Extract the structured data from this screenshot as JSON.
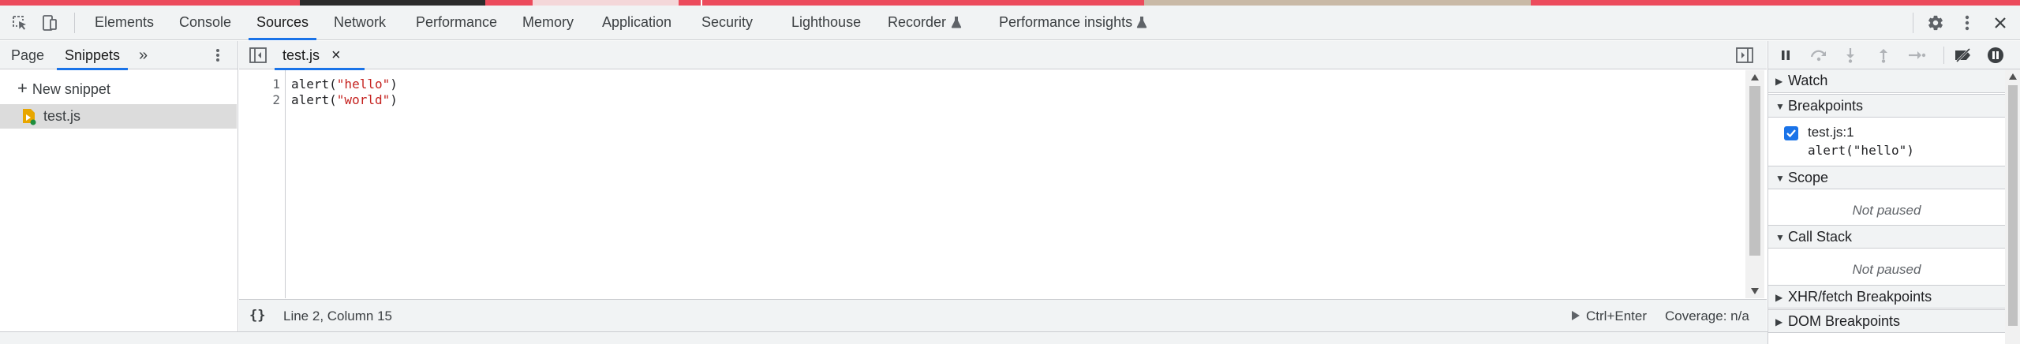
{
  "colors": {
    "accent": "#1a73e8",
    "string": "#c5221f",
    "breakpoint_check": "#1a73e8",
    "snippet_icon": "#e8a600",
    "snippet_dot": "#1e8e3e"
  },
  "toolbar": {
    "icons": [
      "inspect-element-icon",
      "device-toolbar-icon"
    ],
    "tabs": [
      {
        "label": "Elements"
      },
      {
        "label": "Console"
      },
      {
        "label": "Sources"
      },
      {
        "label": "Network"
      },
      {
        "label": "Performance"
      },
      {
        "label": "Memory"
      },
      {
        "label": "Application"
      },
      {
        "label": "Security"
      },
      {
        "label": "Lighthouse"
      },
      {
        "label": "Recorder"
      },
      {
        "label": "Performance insights"
      }
    ],
    "active_tab": "Sources"
  },
  "navigator": {
    "tabs": [
      {
        "label": "Page"
      },
      {
        "label": "Snippets"
      }
    ],
    "more": "»",
    "new_snippet": "New snippet",
    "files": [
      {
        "name": "test.js"
      }
    ]
  },
  "editor": {
    "tab": {
      "name": "test.js",
      "close": "×"
    },
    "lines": [
      {
        "num": "1",
        "pre": "alert(",
        "str": "\"hello\"",
        "post": ")"
      },
      {
        "num": "2",
        "pre": "alert(",
        "str": "\"world\"",
        "post": ")"
      }
    ],
    "status": {
      "format": "{}",
      "position": "Line 2, Column 15",
      "run": "Ctrl+Enter",
      "coverage": "Coverage: n/a"
    }
  },
  "debugger": {
    "sections": {
      "watch": "Watch",
      "breakpoints": "Breakpoints",
      "scope": "Scope",
      "call_stack": "Call Stack",
      "xhr": "XHR/fetch Breakpoints",
      "dom": "DOM Breakpoints"
    },
    "breakpoint": {
      "location": "test.js:1",
      "code": "alert(\"hello\")",
      "checked": true
    },
    "scope_text": "Not paused",
    "callstack_text": "Not paused"
  }
}
